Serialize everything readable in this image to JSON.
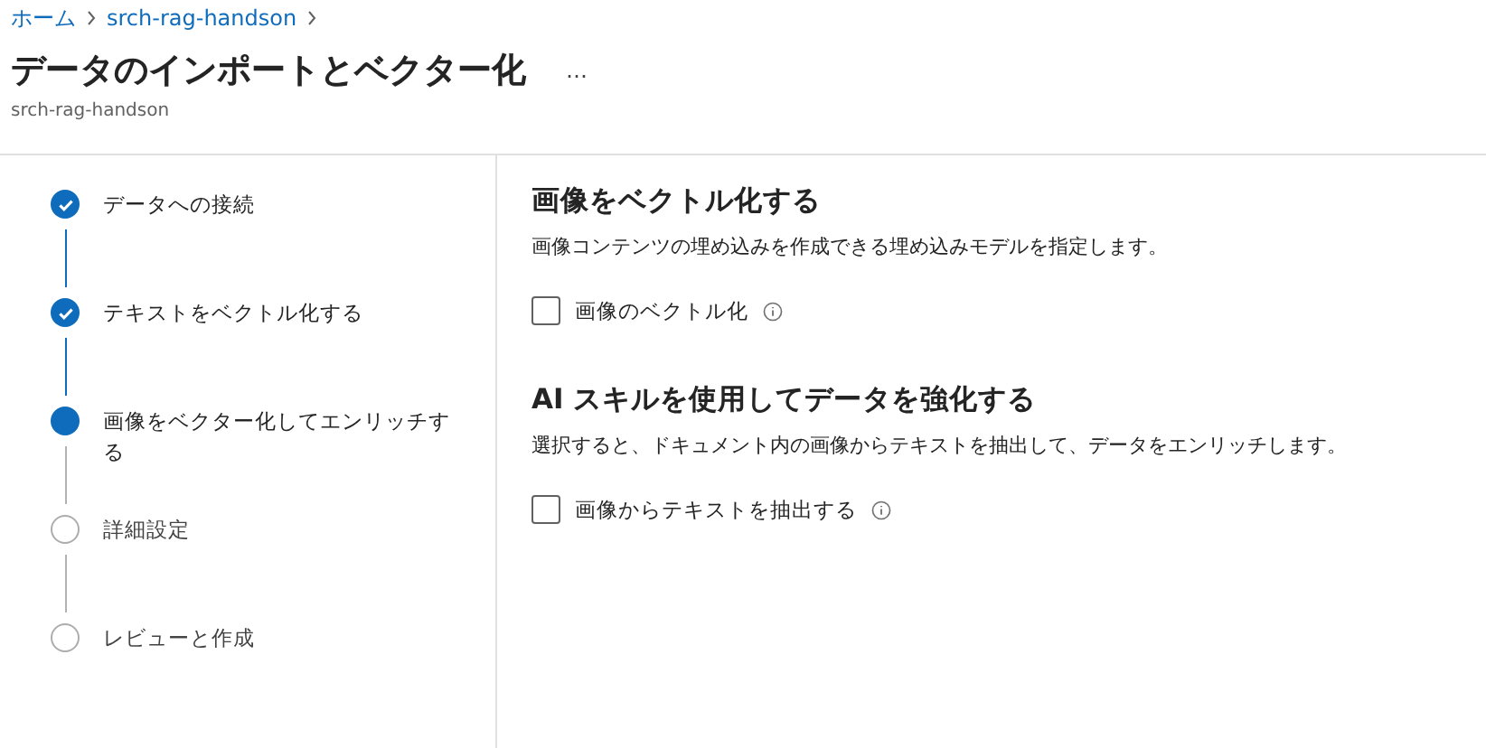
{
  "breadcrumb": [
    {
      "label": "ホーム"
    },
    {
      "label": "srch-rag-handson"
    }
  ],
  "page": {
    "title": "データのインポートとベクター化",
    "more": "…",
    "subtitle": "srch-rag-handson"
  },
  "steps": [
    {
      "label": "データへの接続",
      "kind": "done"
    },
    {
      "label": "テキストをベクトル化する",
      "kind": "done"
    },
    {
      "label": "画像をベクター化してエンリッチする",
      "kind": "current"
    },
    {
      "label": "詳細設定",
      "kind": "todo"
    },
    {
      "label": "レビューと作成",
      "kind": "todo"
    }
  ],
  "sections": [
    {
      "heading": "画像をベクトル化する",
      "description": "画像コンテンツの埋め込みを作成できる埋め込みモデルを指定します。",
      "option": {
        "label": "画像のベクトル化",
        "checked": false
      }
    },
    {
      "heading": "AI スキルを使用してデータを強化する",
      "description": "選択すると、ドキュメント内の画像からテキストを抽出して、データをエンリッチします。",
      "option": {
        "label": "画像からテキストを抽出する",
        "checked": false
      }
    }
  ]
}
